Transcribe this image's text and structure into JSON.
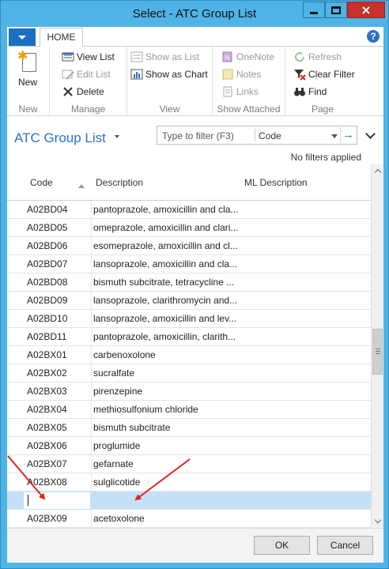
{
  "window": {
    "title": "Select - ATC Group List",
    "close_glyph": "×"
  },
  "ribbon": {
    "tabs": [
      "HOME"
    ],
    "help_glyph": "?",
    "groups": {
      "new": {
        "label": "New",
        "new_button": "New"
      },
      "manage": {
        "label": "Manage",
        "view_list": "View List",
        "edit_list": "Edit List",
        "delete": "Delete"
      },
      "view": {
        "label": "View",
        "show_as_list": "Show as List",
        "show_as_chart": "Show as Chart"
      },
      "show_attached": {
        "label": "Show Attached",
        "onenote": "OneNote",
        "notes": "Notes",
        "links": "Links"
      },
      "page": {
        "label": "Page",
        "refresh": "Refresh",
        "clear_filter": "Clear Filter",
        "find": "Find"
      }
    }
  },
  "header": {
    "page_title": "ATC Group List",
    "filter_placeholder": "Type to filter (F3)",
    "filter_field": "Code",
    "go_glyph": "→",
    "no_filters": "No filters applied"
  },
  "grid": {
    "columns": [
      "Code",
      "Description",
      "ML Description"
    ],
    "rows": [
      {
        "code": "A02BD04",
        "description": "pantoprazole, amoxicillin and cla..."
      },
      {
        "code": "A02BD05",
        "description": "omeprazole, amoxicillin and clari..."
      },
      {
        "code": "A02BD06",
        "description": "esomeprazole, amoxicillin and cl..."
      },
      {
        "code": "A02BD07",
        "description": "lansoprazole, amoxicillin and cla..."
      },
      {
        "code": "A02BD08",
        "description": "bismuth subcitrate, tetracycline ..."
      },
      {
        "code": "A02BD09",
        "description": "lansoprazole, clarithromycin and..."
      },
      {
        "code": "A02BD10",
        "description": "lansoprazole, amoxicillin and lev..."
      },
      {
        "code": "A02BD11",
        "description": "pantoprazole, amoxicillin, clarith..."
      },
      {
        "code": "A02BX01",
        "description": "carbenoxolone"
      },
      {
        "code": "A02BX02",
        "description": "sucralfate"
      },
      {
        "code": "A02BX03",
        "description": "pirenzepine"
      },
      {
        "code": "A02BX04",
        "description": "methiosulfonium chloride"
      },
      {
        "code": "A02BX05",
        "description": "bismuth subcitrate"
      },
      {
        "code": "A02BX06",
        "description": "proglumide"
      },
      {
        "code": "A02BX07",
        "description": "gefarnate"
      },
      {
        "code": "A02BX08",
        "description": "sulglicotide"
      },
      {
        "code": "",
        "description": ""
      },
      {
        "code": "A02BX09",
        "description": "acetoxolone"
      }
    ],
    "selected_row_index": 16,
    "scroll_position_fraction": 0.52
  },
  "footer": {
    "ok": "OK",
    "cancel": "Cancel"
  },
  "colors": {
    "accent": "#2b71c3",
    "selection": "#c4e0f7",
    "title_bar": "#4fb3e6",
    "close": "#c7312c",
    "annotation_arrow": "#e02020"
  }
}
